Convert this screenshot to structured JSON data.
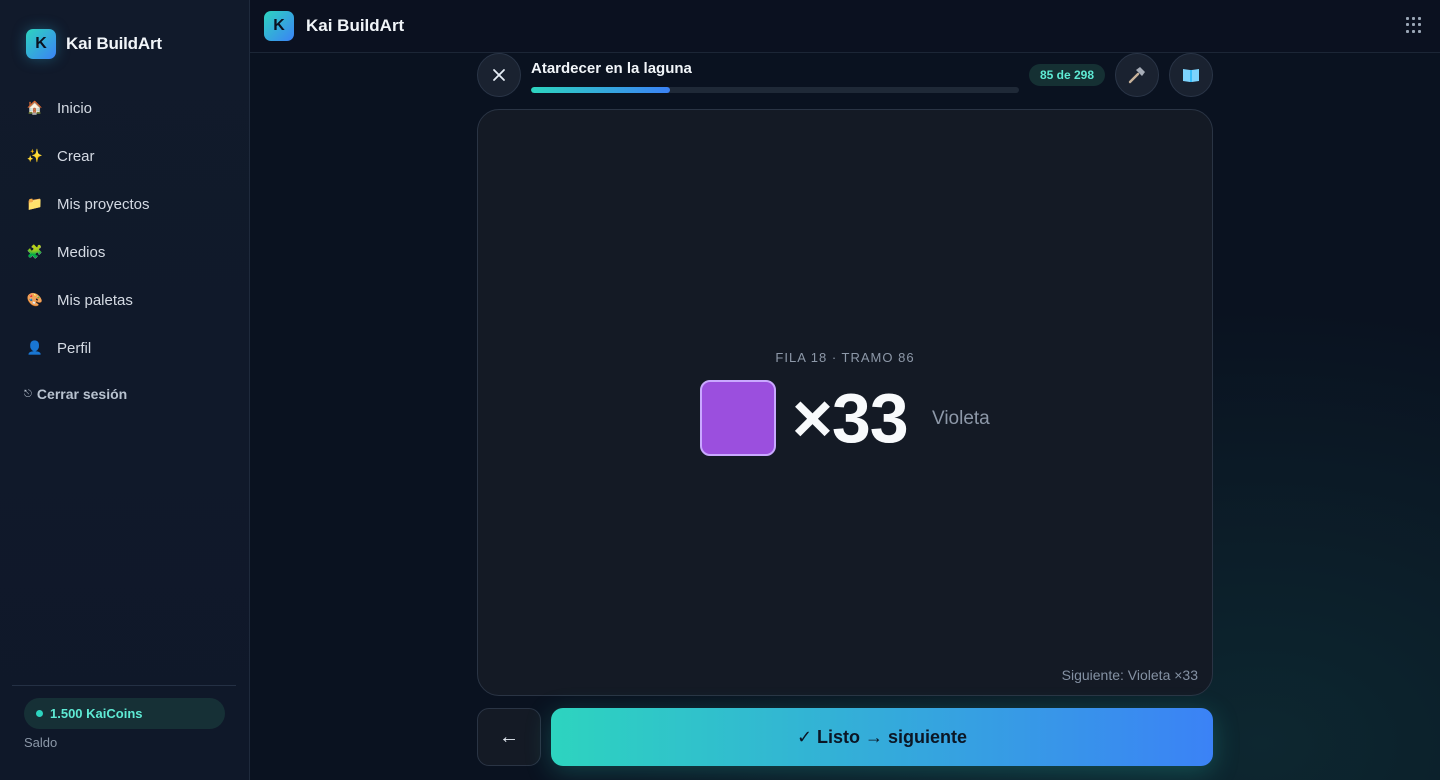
{
  "app": {
    "name": "Kai BuildArt",
    "logo_letter": "K"
  },
  "sidebar": {
    "items": [
      {
        "label": "Inicio",
        "icon": "house-icon",
        "glyph": "🏠"
      },
      {
        "label": "Crear",
        "icon": "sparkles-icon",
        "glyph": "✨"
      },
      {
        "label": "Mis proyectos",
        "icon": "folder-icon",
        "glyph": "📁"
      },
      {
        "label": "Medios",
        "icon": "puzzle-icon",
        "glyph": "🧩"
      },
      {
        "label": "Mis paletas",
        "icon": "palette-icon",
        "glyph": "🎨"
      },
      {
        "label": "Perfil",
        "icon": "user-icon",
        "glyph": "👤"
      }
    ],
    "logout_label": "Cerrar sesión",
    "coins_label": "1.500 KaiCoins",
    "balance_label": "Saldo"
  },
  "project": {
    "title": "Atardecer en la laguna",
    "progress_fraction": 0.285,
    "count_label": "85 de 298"
  },
  "step": {
    "row_label": "FILA 18 · TRAMO 86",
    "color_hex": "#9b4fde",
    "quantity": "×33",
    "color_name": "Violeta",
    "next_label": "Siguiente: Violeta ×33"
  },
  "actions": {
    "back_label": "←",
    "done_label": "✓ Listo → siguiente"
  },
  "colors": {
    "accent_start": "#2dd4bf",
    "accent_end": "#3b82f6"
  }
}
